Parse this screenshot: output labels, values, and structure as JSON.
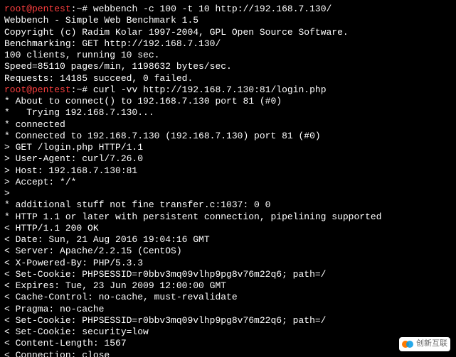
{
  "prompt1": {
    "user": "root@pentest",
    "sep": ":",
    "path": "~",
    "mark": "# ",
    "cmd": "webbench -c 100 -t 10 http://192.168.7.130/"
  },
  "out1": [
    "Webbench - Simple Web Benchmark 1.5",
    "Copyright (c) Radim Kolar 1997-2004, GPL Open Source Software.",
    "",
    "Benchmarking: GET http://192.168.7.130/",
    "100 clients, running 10 sec.",
    "",
    "Speed=85110 pages/min, 1198632 bytes/sec.",
    "Requests: 14185 succeed, 0 failed."
  ],
  "prompt2": {
    "user": "root@pentest",
    "sep": ":",
    "path": "~",
    "mark": "# ",
    "cmd": "curl -vv http://192.168.7.130:81/login.php"
  },
  "out2": [
    "* About to connect() to 192.168.7.130 port 81 (#0)",
    "*   Trying 192.168.7.130...",
    "* connected",
    "* Connected to 192.168.7.130 (192.168.7.130) port 81 (#0)",
    "> GET /login.php HTTP/1.1",
    "> User-Agent: curl/7.26.0",
    "> Host: 192.168.7.130:81",
    "> Accept: */*",
    ">",
    "* additional stuff not fine transfer.c:1037: 0 0",
    "* HTTP 1.1 or later with persistent connection, pipelining supported",
    "< HTTP/1.1 200 OK",
    "< Date: Sun, 21 Aug 2016 19:04:16 GMT",
    "< Server: Apache/2.2.15 (CentOS)",
    "< X-Powered-By: PHP/5.3.3",
    "< Set-Cookie: PHPSESSID=r0bbv3mq09vlhp9pg8v76m22q6; path=/",
    "< Expires: Tue, 23 Jun 2009 12:00:00 GMT",
    "< Cache-Control: no-cache, must-revalidate",
    "< Pragma: no-cache",
    "< Set-Cookie: PHPSESSID=r0bbv3mq09vlhp9pg8v76m22q6; path=/",
    "< Set-Cookie: security=low",
    "< Content-Length: 1567",
    "< Connection: close"
  ],
  "watermark": {
    "text": "创新互联"
  }
}
